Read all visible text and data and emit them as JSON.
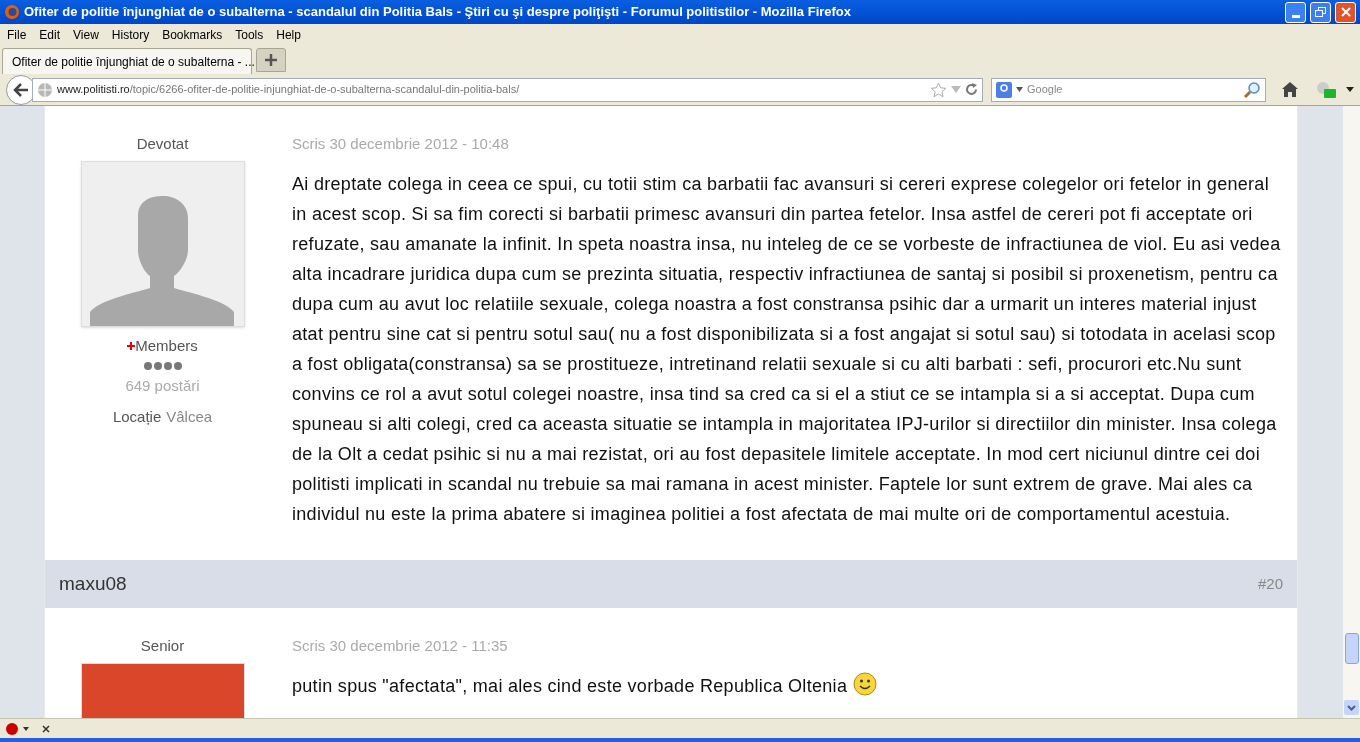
{
  "window": {
    "title": "Ofiter de politie înjunghiat de o subalterna - scandalul din Politia Bals - Ştiri cu şi despre poliţişti - Forumul politistilor - Mozilla Firefox"
  },
  "menu": [
    "File",
    "Edit",
    "View",
    "History",
    "Bookmarks",
    "Tools",
    "Help"
  ],
  "tabs": [
    {
      "label": "Ofiter de politie înjunghiat de o subalterna - ...",
      "selected": true
    }
  ],
  "address": {
    "domain": "www.politisti.ro",
    "path": "/topic/6266-ofiter-de-politie-injunghiat-de-o-subalterna-scandalul-din-politia-bals/"
  },
  "search": {
    "placeholder": "Google"
  },
  "posts": [
    {
      "rank": "Devotat",
      "avatar": {
        "kind": "silhouette"
      },
      "group": "Members",
      "post_count": "649 postări",
      "location_label": "Locație",
      "location": "Vâlcea",
      "date": "Scris 30 decembrie 2012 - 10:48",
      "body": "Ai dreptate colega in ceea ce spui, cu totii stim ca barbatii fac avansuri si cereri exprese colegelor ori fetelor in general in acest scop. Si sa fim corecti si barbatii primesc avansuri din partea fetelor. Insa astfel de cereri pot fi acceptate ori refuzate, sau amanate la infinit. In speta noastra insa, nu inteleg de ce se vorbeste de infractiunea de viol. Eu asi vedea alta incadrare juridica dupa cum se prezinta situatia, respectiv infractiunea de santaj si posibil si proxenetism, pentru ca dupa cum au avut loc relatiile sexuale, colega noastra a fost constransa psihic dar a urmarit un interes material injust atat pentru sine cat si pentru sotul sau( nu a fost disponibilizata si a fost angajat si sotul sau) si totodata in acelasi scop a fost obligata(constransa) sa se prostitueze, intretinand relatii sexuale si cu alti barbati : sefi, procurori etc.Nu sunt convins ce rol a avut sotul colegei noastre, insa tind sa cred ca si el a stiut ce se intampla si a si acceptat. Dupa cum spuneau si alti colegi, cred ca aceasta situatie se intampla in majoritatea IPJ-urilor si directiilor din minister. Insa colega de la Olt a cedat psihic si nu a mai rezistat, ori au fost depasitele limitele acceptate. In mod cert niciunul dintre cei doi politisti implicati in scandal nu trebuie sa mai ramana in acest minister. Faptele lor sunt extrem de grave. Mai ales ca individul nu este la prima abatere si imaginea politiei a fost afectata de mai multe ori de comportamentul acestuia.",
      "emoticon": false
    },
    {
      "author": "maxu08",
      "number": "#20",
      "rank": "Senior",
      "avatar": {
        "kind": "photo"
      },
      "date": "Scris 30 decembrie 2012 - 11:35",
      "body": "putin spus \"afectata\", mai ales cind este vorbade Republica Oltenia",
      "emoticon": true
    }
  ]
}
